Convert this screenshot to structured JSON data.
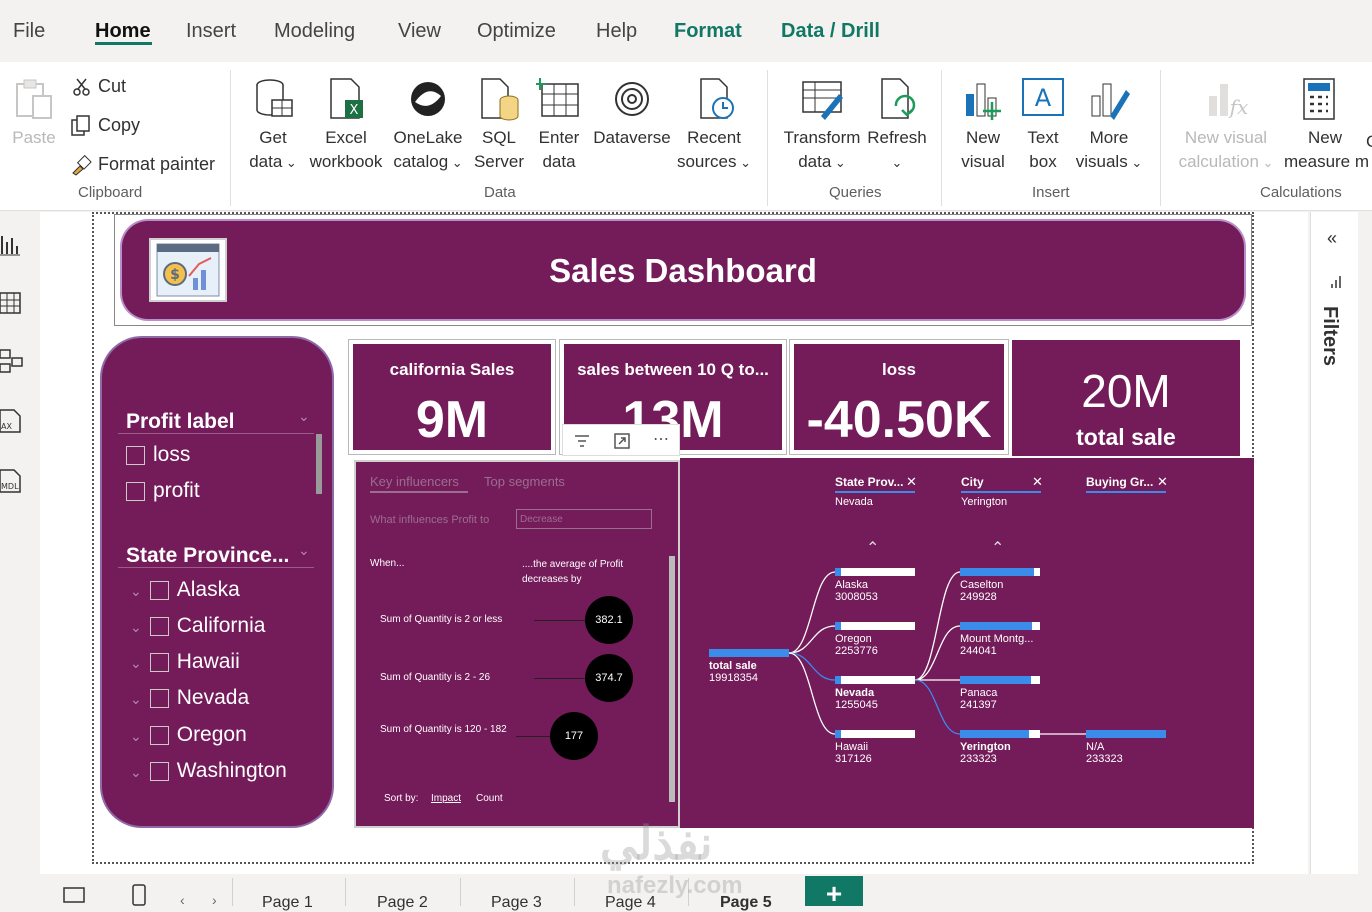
{
  "menu": {
    "tabs": [
      {
        "label": "File"
      },
      {
        "label": "Home"
      },
      {
        "label": "Insert"
      },
      {
        "label": "Modeling"
      },
      {
        "label": "View"
      },
      {
        "label": "Optimize"
      },
      {
        "label": "Help"
      },
      {
        "label": "Format"
      },
      {
        "label": "Data / Drill"
      }
    ],
    "active": "Home"
  },
  "ribbon": {
    "clipboard": {
      "paste": "Paste",
      "cut": "Cut",
      "copy": "Copy",
      "format_painter": "Format painter",
      "group": "Clipboard"
    },
    "data": {
      "get_data": [
        "Get",
        "data"
      ],
      "excel": [
        "Excel",
        "workbook"
      ],
      "onelake": [
        "OneLake",
        "catalog"
      ],
      "sql": [
        "SQL",
        "Server"
      ],
      "enter": [
        "Enter",
        "data"
      ],
      "dataverse": "Dataverse",
      "recent": [
        "Recent",
        "sources"
      ],
      "group": "Data"
    },
    "queries": {
      "transform": [
        "Transform",
        "data"
      ],
      "refresh": "Refresh",
      "group": "Queries"
    },
    "insert": {
      "new_visual": [
        "New",
        "visual"
      ],
      "text_box": [
        "Text",
        "box"
      ],
      "more_visuals": [
        "More",
        "visuals"
      ],
      "group": "Insert"
    },
    "calculations": {
      "new_visual_calc": [
        "New visual",
        "calculation"
      ],
      "new_measure": [
        "New",
        "measure m"
      ],
      "extra": "C",
      "group": "Calculations"
    },
    "colors": {
      "accent": "#117865"
    }
  },
  "report": {
    "title": "Sales Dashboard",
    "colors": {
      "panel": "#741b5a",
      "highlight": "#3b8beb"
    },
    "slicer": {
      "profit_label": "Profit label",
      "profit_items": [
        "loss",
        "profit"
      ],
      "state_label": "State Province...",
      "state_items": [
        "Alaska",
        "California",
        "Hawaii",
        "Nevada",
        "Oregon",
        "Washington"
      ]
    },
    "cards": [
      {
        "title": "california Sales",
        "value": "9M"
      },
      {
        "title": "sales between 10 Q to...",
        "value": "13M"
      },
      {
        "title": "loss",
        "value": "-40.50K"
      }
    ],
    "total_card": {
      "value": "20M",
      "label": "total sale"
    },
    "key_influencers": {
      "tab1": "Key influencers",
      "tab2": "Top segments",
      "question": "What influences Profit to",
      "dropdown": "Decrease",
      "when": "When...",
      "avg_label": "....the average of Profit decreases by",
      "rows": [
        {
          "label": "Sum of Quantity is 2 or less",
          "value": "382.1"
        },
        {
          "label": "Sum of Quantity is 2 - 26",
          "value": "374.7"
        },
        {
          "label": "Sum of Quantity is 120 - 182",
          "value": "177"
        }
      ],
      "sort_by": "Sort by:",
      "sort_impact": "Impact",
      "sort_count": "Count"
    },
    "decomposition_tree": {
      "levels": [
        {
          "header": "State Prov...",
          "selected": "Nevada"
        },
        {
          "header": "City",
          "selected": "Yerington"
        },
        {
          "header": "Buying Gr...",
          "selected": ""
        }
      ],
      "root": {
        "label": "total sale",
        "value": "19918354"
      },
      "states": [
        {
          "name": "Alaska",
          "value": "3008053",
          "fill": 0.08
        },
        {
          "name": "Oregon",
          "value": "2253776",
          "fill": 0.06
        },
        {
          "name": "Nevada",
          "value": "1255045",
          "fill": 0.04
        },
        {
          "name": "Hawaii",
          "value": "317126",
          "fill": 0.01
        }
      ],
      "cities": [
        {
          "name": "Caselton",
          "value": "249928",
          "fill": 0.92
        },
        {
          "name": "Mount Montg...",
          "value": "244041",
          "fill": 0.9
        },
        {
          "name": "Panaca",
          "value": "241397",
          "fill": 0.89
        },
        {
          "name": "Yerington",
          "value": "233323",
          "fill": 0.86
        }
      ],
      "buying": [
        {
          "name": "N/A",
          "value": "233323",
          "fill": 1.0
        }
      ]
    }
  },
  "filters_pane": {
    "label": "Filters"
  },
  "pages": [
    "Page 1",
    "Page 2",
    "Page 3",
    "Page 4",
    "Page 5"
  ],
  "watermark": {
    "line1": "نفذلي",
    "line2": "nafezly.com"
  }
}
